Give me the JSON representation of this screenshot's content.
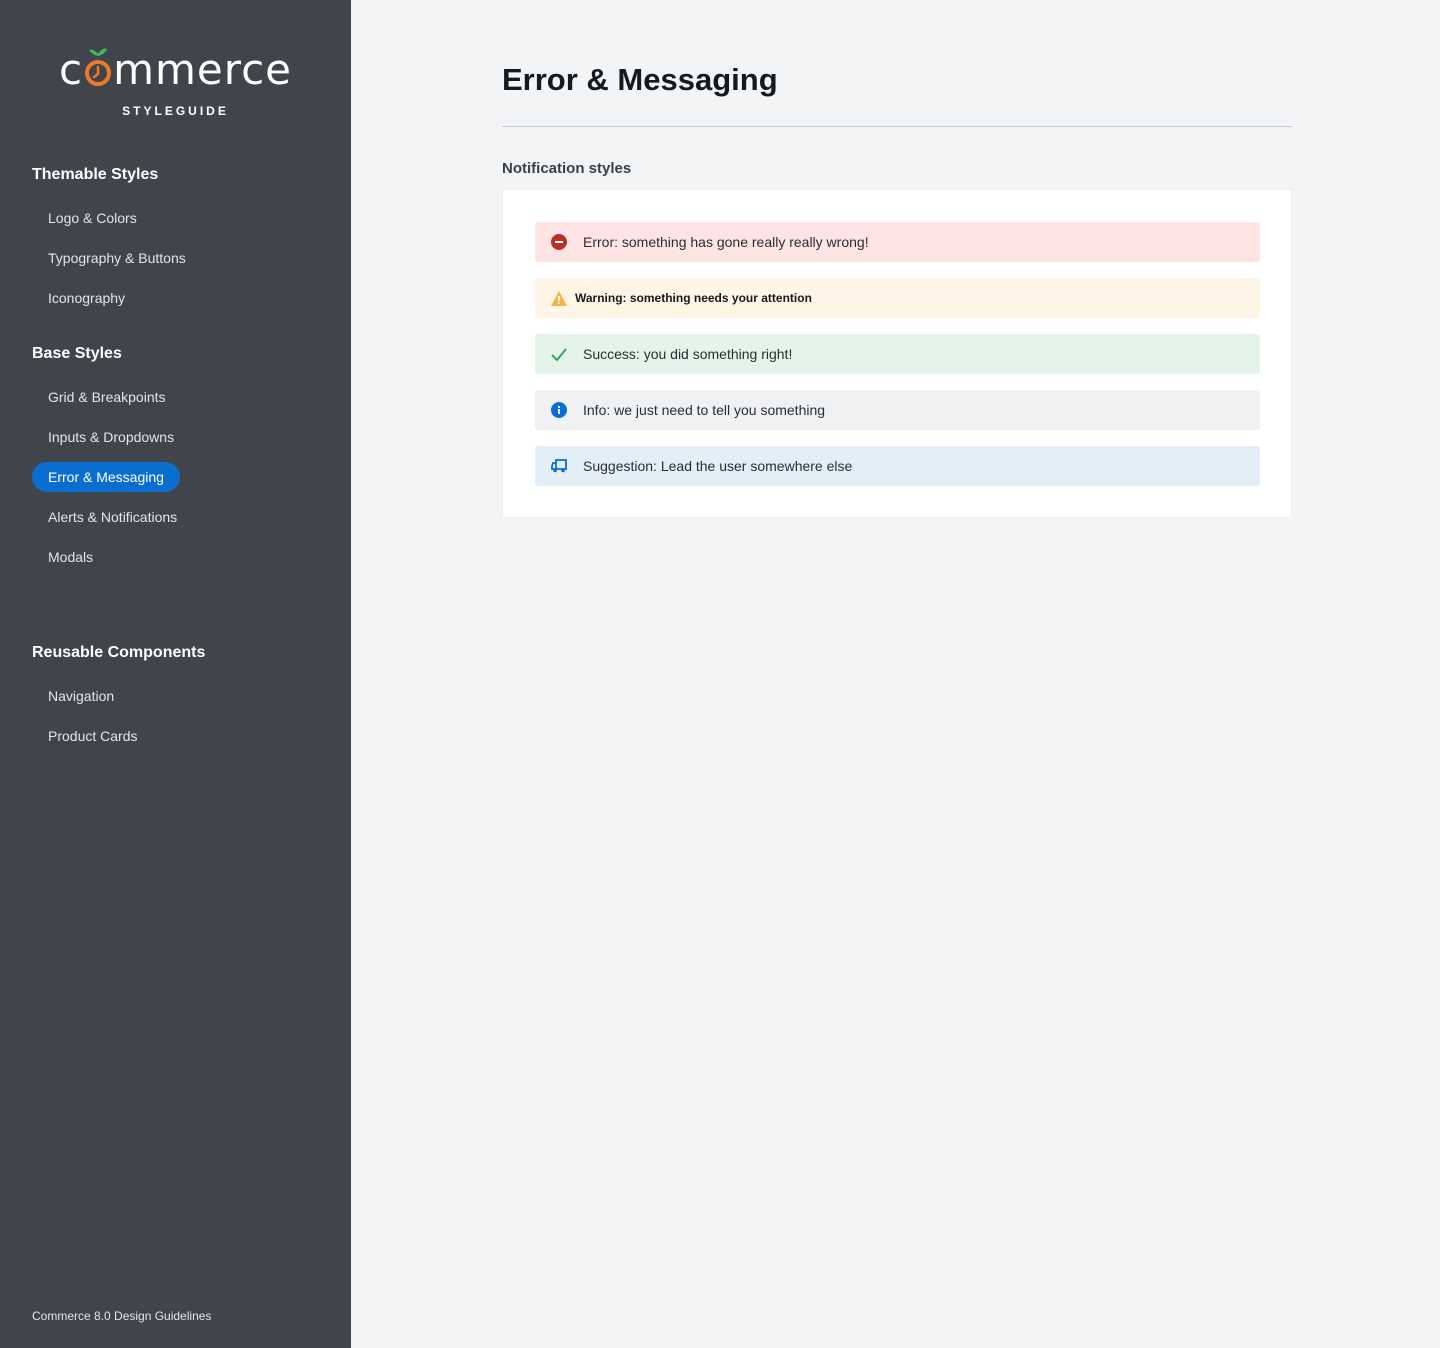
{
  "sidebar": {
    "logo": {
      "text_before": "c",
      "text_after": "mmerce",
      "subtitle": "STYLEGUIDE"
    },
    "sections": [
      {
        "heading": "Themable Styles",
        "items": [
          {
            "label": "Logo & Colors"
          },
          {
            "label": "Typography & Buttons"
          },
          {
            "label": "Iconography"
          }
        ]
      },
      {
        "heading": "Base Styles",
        "items": [
          {
            "label": "Grid & Breakpoints"
          },
          {
            "label": "Inputs & Dropdowns"
          },
          {
            "label": "Error & Messaging",
            "active": true
          },
          {
            "label": "Alerts & Notifications"
          },
          {
            "label": "Modals"
          }
        ]
      },
      {
        "heading": "Reusable Components",
        "items": [
          {
            "label": "Navigation"
          },
          {
            "label": "Product Cards"
          }
        ]
      }
    ],
    "footer": "Commerce 8.0 Design Guidelines"
  },
  "main": {
    "title": "Error & Messaging",
    "section_title": "Notification styles",
    "messages": [
      {
        "type": "error",
        "icon": "minus-circle-icon",
        "text": "Error: something has gone really really wrong!",
        "background": "#fee4e2",
        "icon_color": "#bb2f2b"
      },
      {
        "type": "warning",
        "icon": "warning-triangle-icon",
        "text": "Warning: something needs your attention",
        "background": "#fef5e6",
        "icon_color": "#f7b244"
      },
      {
        "type": "success",
        "icon": "checkmark-icon",
        "text": "Success: you did something right!",
        "background": "#e4f4ea",
        "icon_color": "#3aa35c"
      },
      {
        "type": "info",
        "icon": "info-circle-icon",
        "text": "Info: we just need to tell you something",
        "background": "#f0f1f3",
        "icon_color": "#0a6ed1"
      },
      {
        "type": "suggestion",
        "icon": "truck-icon",
        "text": "Suggestion: Lead the user somewhere else",
        "background": "#e3eef9",
        "icon_color": "#0a6ed1"
      }
    ]
  },
  "colors": {
    "sidebar_bg": "#40454b",
    "accent": "#0a6ed1",
    "page_bg": "#f3f4f6",
    "logo_orange": "#f0782a",
    "logo_leaf": "#3cc05a"
  }
}
